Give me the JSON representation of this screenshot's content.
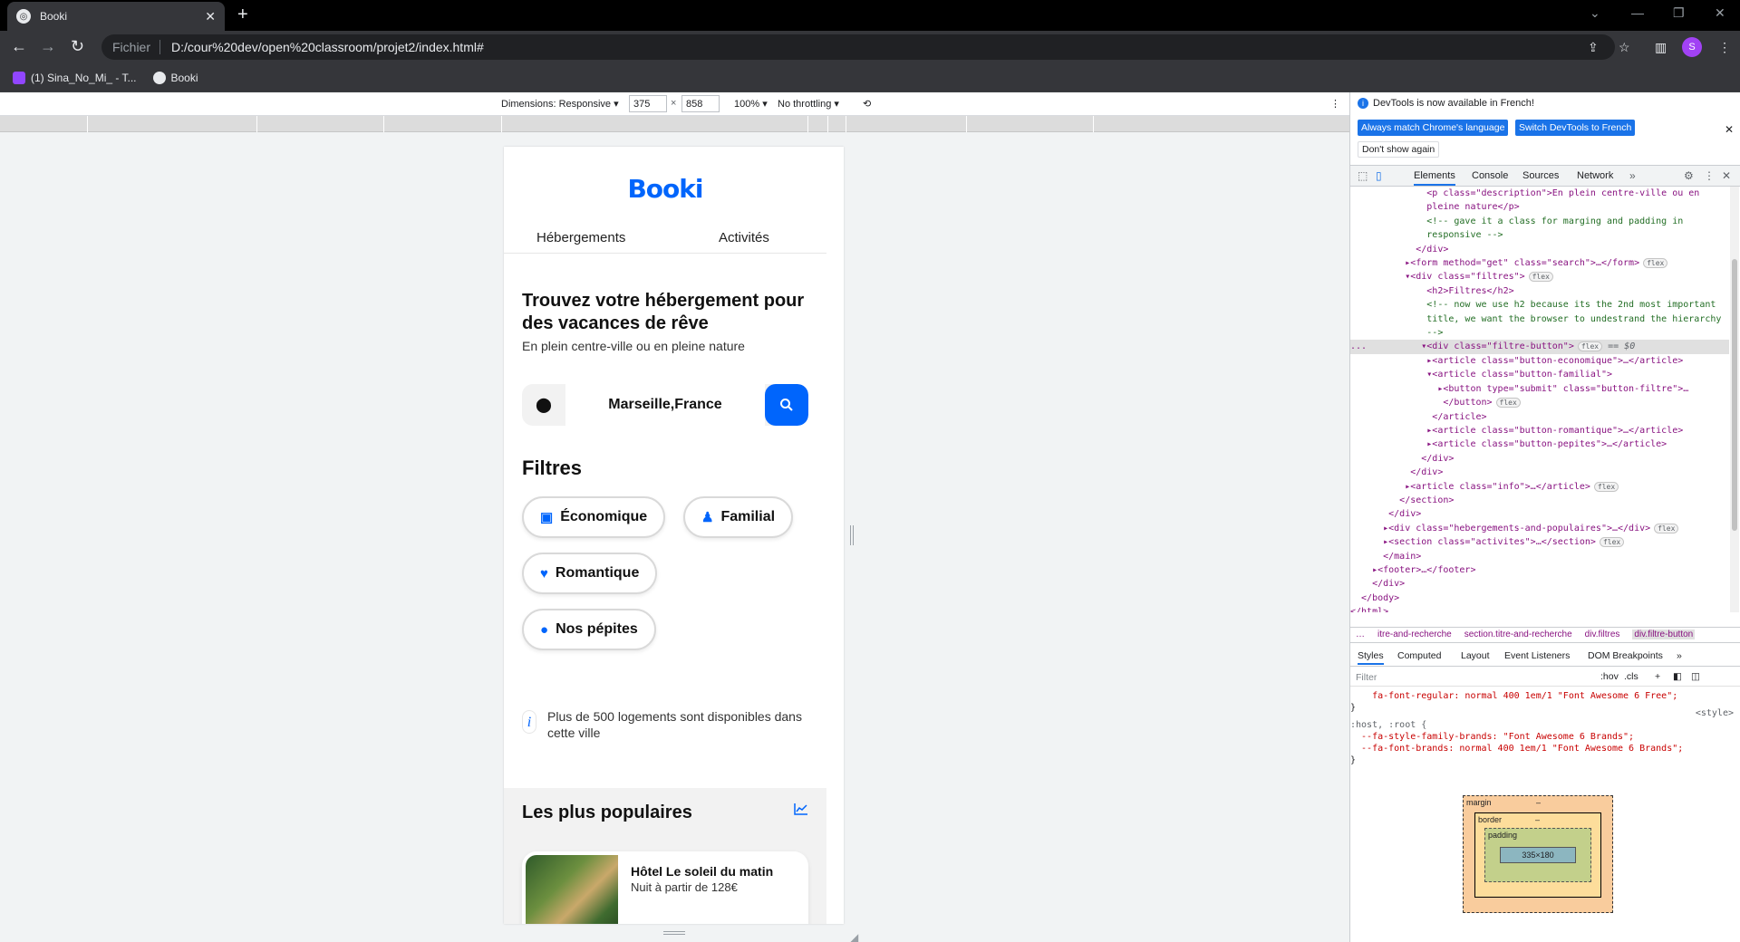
{
  "browser": {
    "tab_title": "Booki",
    "url_scheme": "Fichier",
    "url": "D:/cour%20dev/open%20classroom/projet2/index.html#",
    "profile_initial": "S",
    "bookmarks": [
      {
        "label": "(1) Sina_No_Mi_ - T...",
        "icon": "twitch-icon"
      },
      {
        "label": "Booki",
        "icon": "globe-icon"
      }
    ]
  },
  "device_toolbar": {
    "dimensions_label": "Dimensions: Responsive ▾",
    "width": "375",
    "height": "858",
    "zoom": "100% ▾",
    "throttle": "No throttling ▾"
  },
  "page": {
    "logo": "Booki",
    "nav": [
      "Hébergements",
      "Activités"
    ],
    "heading": "Trouvez votre hébergement pour des vacances de rêve",
    "subtitle": "En plein centre-ville ou en pleine nature",
    "search_value": "Marseille,France",
    "filters_title": "Filtres",
    "filters": [
      {
        "label": "Économique",
        "icon": "money-icon"
      },
      {
        "label": "Familial",
        "icon": "child-icon"
      },
      {
        "label": "Romantique",
        "icon": "heart-icon"
      },
      {
        "label": "Nos pépites",
        "icon": "fire-icon"
      }
    ],
    "info_text": "Plus de 500 logements sont disponibles dans cette ville",
    "popular_title": "Les plus populaires",
    "card": {
      "name": "Hôtel Le soleil du matin",
      "price": "Nuit à partir de 128€"
    }
  },
  "devtools": {
    "notice": "DevTools is now available in French!",
    "btn_match": "Always match Chrome's language",
    "btn_switch": "Switch DevTools to French",
    "btn_dont": "Don't show again",
    "tabs": [
      "Elements",
      "Console",
      "Sources",
      "Network"
    ],
    "breadcrumbs": [
      "itre-and-recherche",
      "section.titre-and-recherche",
      "div.filtres",
      "div.filtre-button"
    ],
    "sub_tabs": [
      "Styles",
      "Computed",
      "Layout",
      "Event Listeners",
      "DOM Breakpoints"
    ],
    "filter_placeholder": "Filter",
    "hov": ":hov",
    "cls": ".cls",
    "boxmodel": {
      "margin": "margin",
      "border": "border",
      "padding": "padding",
      "content": "335×180",
      "dash": "–"
    },
    "styles": {
      "line0": "    fa-font-regular: normal 400 1em/1 \"Font Awesome 6 Free\";",
      "line1": "}",
      "line2": ":host, :root {",
      "line2_src": "<style>",
      "line3": "  --fa-style-family-brands: \"Font Awesome 6 Brands\";",
      "line4": "  --fa-font-brands: normal 400 1em/1 \"Font Awesome 6 Brands\";",
      "line5": "}"
    },
    "code": [
      {
        "text": "              <p class=\"description\">En plein centre-ville ou en"
      },
      {
        "text": "              pleine nature</p>"
      },
      {
        "text": "              <!-- gave it a class for marging and padding in"
      },
      {
        "text": "              responsive -->"
      },
      {
        "text": "            </div>"
      },
      {
        "text": "          ▸<form method=\"get\" class=\"search\">…</form>",
        "badge": "flex"
      },
      {
        "text": "          ▾<div class=\"filtres\">",
        "badge": "flex"
      },
      {
        "text": "              <h2>Filtres</h2>"
      },
      {
        "text": "              <!-- now we use h2 because its the 2nd most important"
      },
      {
        "text": "              title, we want the browser to undestrand the hierarchy"
      },
      {
        "text": "              -->"
      },
      {
        "text": "...          ▾<div class=\"filtre-button\">",
        "badge": "flex",
        "extra": " == $0",
        "sel": true
      },
      {
        "text": "              ▸<article class=\"button-economique\">…</article>"
      },
      {
        "text": "              ▾<article class=\"button-familial\">"
      },
      {
        "text": "                ▸<button type=\"submit\" class=\"button-filtre\">…"
      },
      {
        "text": "                 </button>",
        "badge": "flex"
      },
      {
        "text": "               </article>"
      },
      {
        "text": "              ▸<article class=\"button-romantique\">…</article>"
      },
      {
        "text": "              ▸<article class=\"button-pepites\">…</article>"
      },
      {
        "text": "             </div>"
      },
      {
        "text": "           </div>"
      },
      {
        "text": "          ▸<article class=\"info\">…</article>",
        "badge": "flex"
      },
      {
        "text": "         </section>"
      },
      {
        "text": "       </div>"
      },
      {
        "text": "      ▸<div class=\"hebergements-and-populaires\">…</div>",
        "badge": "flex"
      },
      {
        "text": "      ▸<section class=\"activites\">…</section>",
        "badge": "flex"
      },
      {
        "text": "      </main>"
      },
      {
        "text": "    ▸<footer>…</footer>"
      },
      {
        "text": "    </div>"
      },
      {
        "text": "  </body>"
      },
      {
        "text": "</html>"
      }
    ]
  },
  "colors": {
    "accent": "#0065fc",
    "devtools_blue": "#1a73e8"
  }
}
